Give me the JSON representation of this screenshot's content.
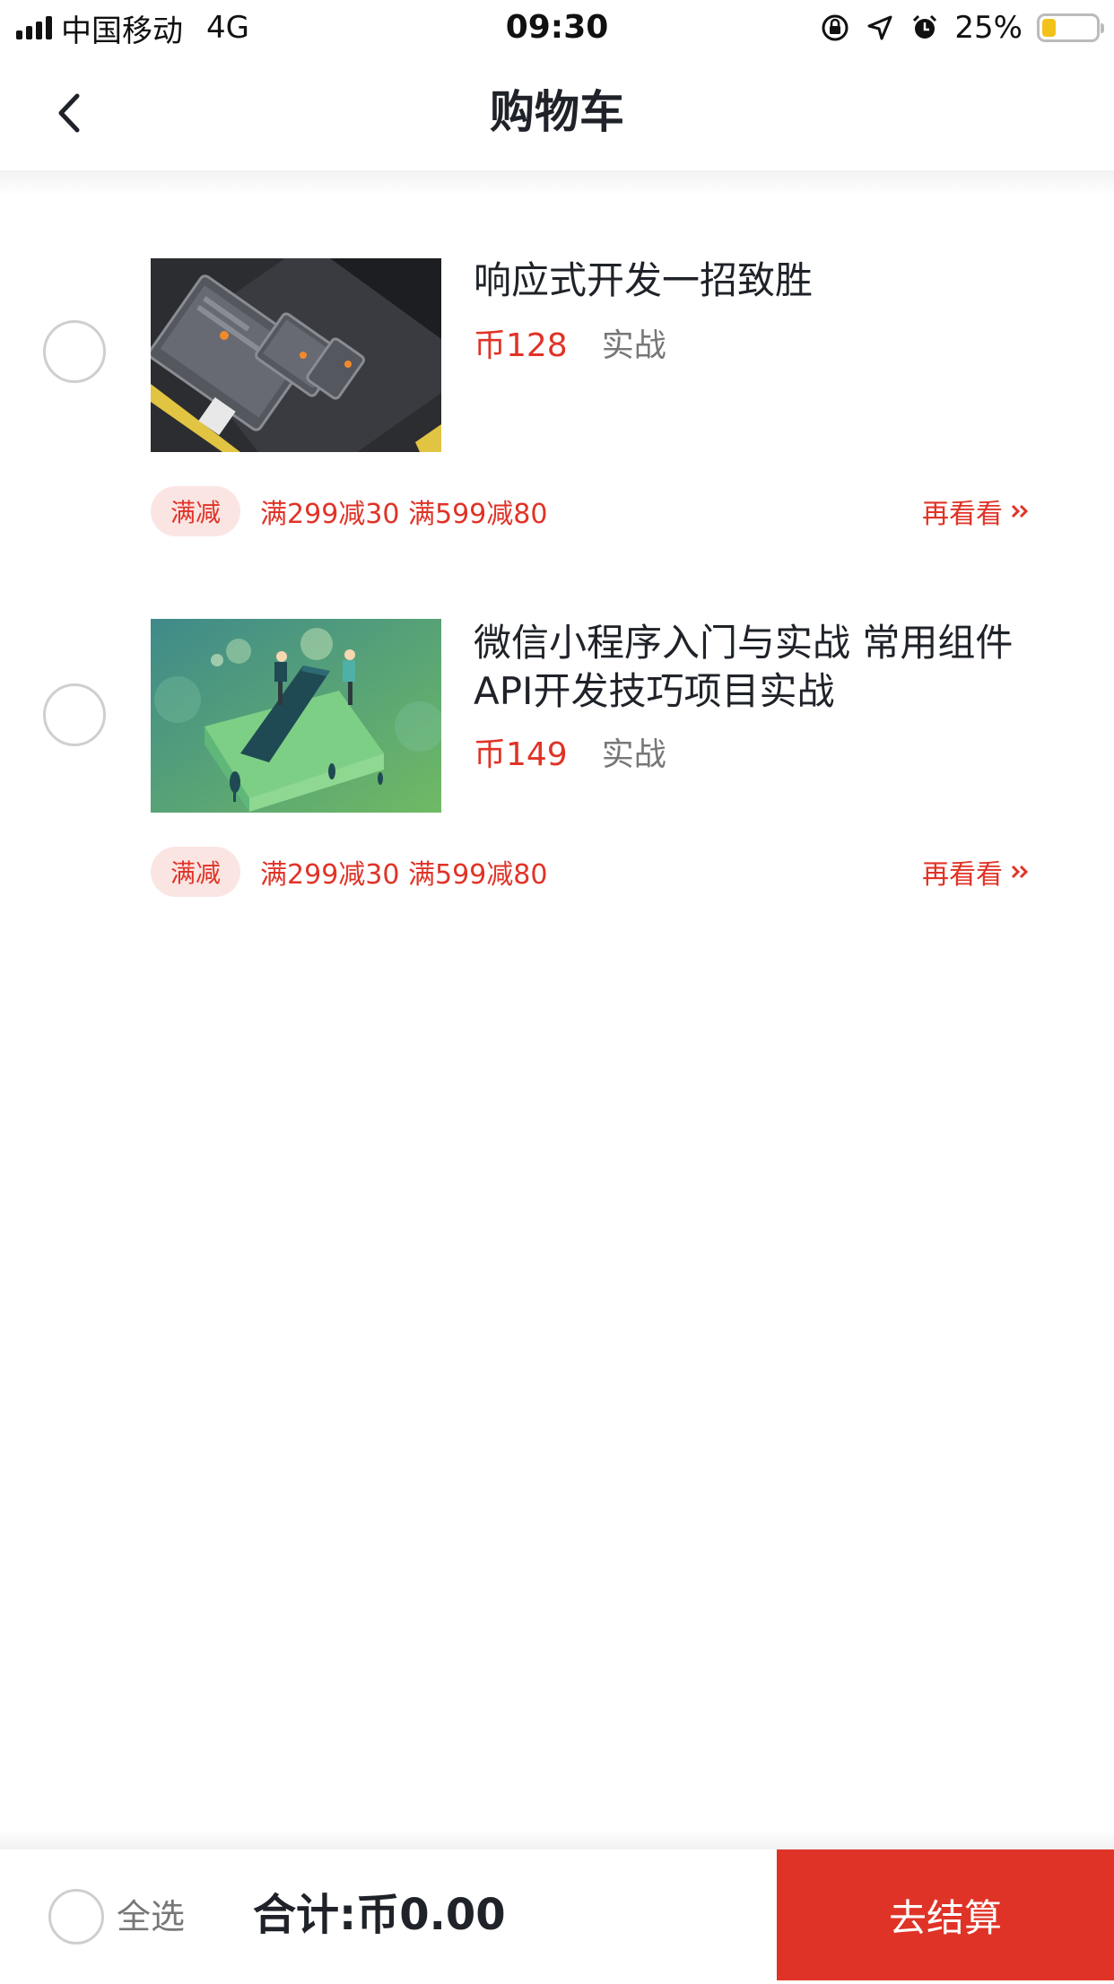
{
  "status_bar": {
    "carrier": "中国移动",
    "network": "4G",
    "time": "09:30",
    "battery": "25%",
    "battery_level": 0.25,
    "icons": [
      "signal-icon",
      "orientation-lock-icon",
      "location-icon",
      "alarm-icon",
      "battery-icon"
    ]
  },
  "nav": {
    "title": "购物车",
    "back_icon": "chevron-left-icon"
  },
  "items": [
    {
      "title": "响应式开发一招致胜",
      "price": "币128",
      "tag": "实战",
      "promo_badge": "满减",
      "promo_text": "满299减30 满599减80",
      "see_again": "再看看",
      "see_again_icon": "double-chevron-right-icon",
      "thumbnail": "responsive-devices-illustration"
    },
    {
      "title": "微信小程序入门与实战 常用组件API开发技巧项目实战",
      "price": "币149",
      "tag": "实战",
      "promo_badge": "满减",
      "promo_text": "满299减30 满599减80",
      "see_again": "再看看",
      "see_again_icon": "double-chevron-right-icon",
      "thumbnail": "box-phone-illustration"
    }
  ],
  "footer": {
    "select_all": "全选",
    "total": "合计:币0.00",
    "checkout": "去结算"
  },
  "colors": {
    "accent": "#e03327",
    "promo_bg": "#fbe5e3",
    "text": "#1f2329",
    "muted": "#777777",
    "battery": "#f2c21b"
  }
}
